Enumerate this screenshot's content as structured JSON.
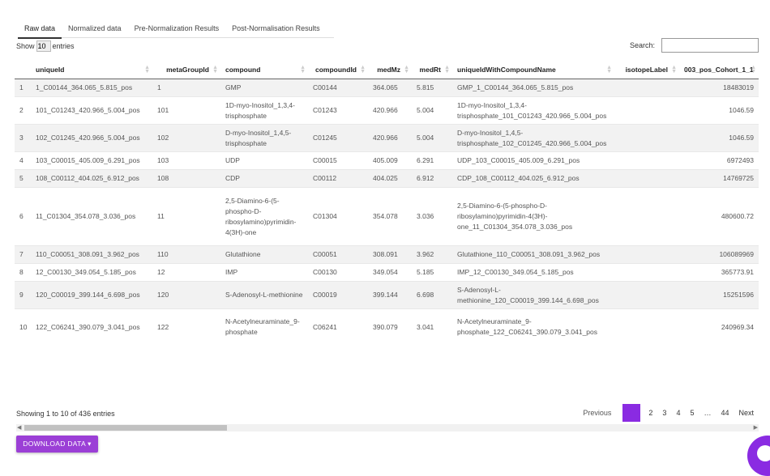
{
  "tabs": [
    "Raw data",
    "Normalized data",
    "Pre-Normalization Results",
    "Post-Normalisation Results"
  ],
  "length_control": {
    "show": "Show",
    "value": "10",
    "entries": "entries"
  },
  "search": {
    "label": "Search:",
    "value": ""
  },
  "columns": [
    "",
    "uniqueId",
    "metaGroupId",
    "compound",
    "compoundId",
    "medMz",
    "medRt",
    "uniqueIdWithCompoundName",
    "isotopeLabel",
    "003_pos_Cohort_1_1"
  ],
  "rows": [
    [
      "1",
      "1_C00144_364.065_5.815_pos",
      "1",
      "GMP",
      "C00144",
      "364.065",
      "5.815",
      "GMP_1_C00144_364.065_5.815_pos",
      "",
      "18483019"
    ],
    [
      "2",
      "101_C01243_420.966_5.004_pos",
      "101",
      "1D-myo-Inositol_1,3,4-trisphosphate",
      "C01243",
      "420.966",
      "5.004",
      "1D-myo-Inositol_1,3,4-trisphosphate_101_C01243_420.966_5.004_pos",
      "",
      "1046.59"
    ],
    [
      "3",
      "102_C01245_420.966_5.004_pos",
      "102",
      "D-myo-Inositol_1,4,5-trisphosphate",
      "C01245",
      "420.966",
      "5.004",
      "D-myo-Inositol_1,4,5-trisphosphate_102_C01245_420.966_5.004_pos",
      "",
      "1046.59"
    ],
    [
      "4",
      "103_C00015_405.009_6.291_pos",
      "103",
      "UDP",
      "C00015",
      "405.009",
      "6.291",
      "UDP_103_C00015_405.009_6.291_pos",
      "",
      "6972493"
    ],
    [
      "5",
      "108_C00112_404.025_6.912_pos",
      "108",
      "CDP",
      "C00112",
      "404.025",
      "6.912",
      "CDP_108_C00112_404.025_6.912_pos",
      "",
      "14769725"
    ],
    [
      "6",
      "11_C01304_354.078_3.036_pos",
      "11",
      "2,5-Diamino-6-(5-phospho-D-ribosylamino)pyrimidin-4(3H)-one",
      "C01304",
      "354.078",
      "3.036",
      "2,5-Diamino-6-(5-phospho-D-ribosylamino)pyrimidin-4(3H)-one_11_C01304_354.078_3.036_pos",
      "",
      "480600.72"
    ],
    [
      "7",
      "110_C00051_308.091_3.962_pos",
      "110",
      "Glutathione",
      "C00051",
      "308.091",
      "3.962",
      "Glutathione_110_C00051_308.091_3.962_pos",
      "",
      "106089969"
    ],
    [
      "8",
      "12_C00130_349.054_5.185_pos",
      "12",
      "IMP",
      "C00130",
      "349.054",
      "5.185",
      "IMP_12_C00130_349.054_5.185_pos",
      "",
      "365773.91"
    ],
    [
      "9",
      "120_C00019_399.144_6.698_pos",
      "120",
      "S-Adenosyl-L-methionine",
      "C00019",
      "399.144",
      "6.698",
      "S-Adenosyl-L-methionine_120_C00019_399.144_6.698_pos",
      "",
      "15251596"
    ],
    [
      "10",
      "122_C06241_390.079_3.041_pos",
      "122",
      "N-Acetylneuraminate_9-phosphate",
      "C06241",
      "390.079",
      "3.041",
      "N-Acetylneuraminate_9-phosphate_122_C06241_390.079_3.041_pos",
      "",
      "240969.34"
    ]
  ],
  "info": "Showing 1 to 10 of 436 entries",
  "pagination": {
    "previous": "Previous",
    "current": "1",
    "pages": [
      "2",
      "3",
      "4",
      "5"
    ],
    "ellipsis": "…",
    "last": "44",
    "next": "Next"
  },
  "download_button": "DOWNLOAD DATA ▾",
  "colors": {
    "accent": "#8a2be2",
    "button": "#9b3fd6"
  }
}
